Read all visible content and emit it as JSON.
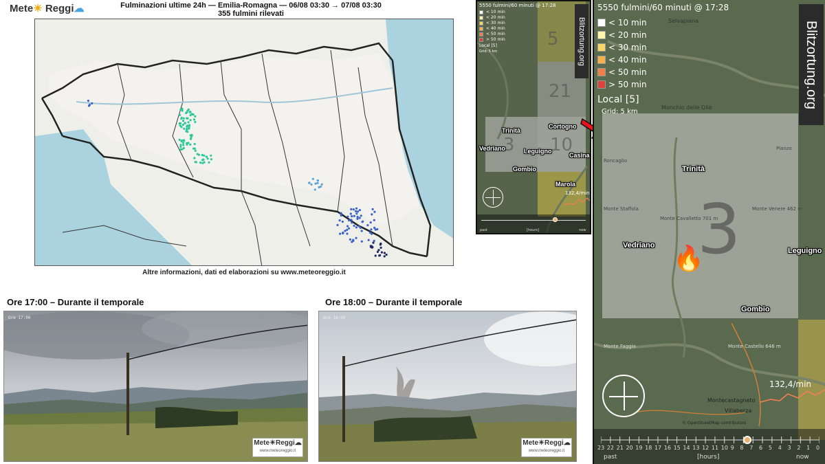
{
  "brand": {
    "name_a": "Mete",
    "name_b": "Reggi",
    "sun": "☀",
    "cloud": "☁"
  },
  "map": {
    "title_line1": "Fulminazioni ultime 24h — Emilia-Romagna — 06/08 03:30 → 07/08 03:30",
    "title_line2": "355 fulmini rilevati",
    "footer": "Altre informazioni, dati ed elaborazioni su www.meteoreggio.it"
  },
  "webcams": [
    {
      "caption": "Ore 17:00 – Durante il temporale",
      "logo": "Mete☀Reggi☁",
      "url": "www.meteoreggio.it"
    },
    {
      "caption": "Ore 18:00 – Durante il temporale",
      "logo": "Mete☀Reggi☁",
      "url": "www.meteoreggio.it"
    }
  ],
  "blitz_small": {
    "header": "5550 fulmini/60 minuti @ 17:28",
    "brand": "Blitzortung.org",
    "legend": [
      {
        "label": "< 10 min",
        "color": "#ffffff"
      },
      {
        "label": "< 20 min",
        "color": "#fff3b0"
      },
      {
        "label": "< 30 min",
        "color": "#f6d56b"
      },
      {
        "label": "< 40 min",
        "color": "#f3b04c"
      },
      {
        "label": "< 50 min",
        "color": "#ef7f49"
      },
      {
        "label": "> 50 min",
        "color": "#d9443c"
      }
    ],
    "local": "Local [5]",
    "grid": "Grid: 5 km",
    "cells": [
      "5",
      "21",
      "3",
      "10"
    ],
    "places": [
      "Trinità",
      "Cortogno",
      "Vedriano",
      "Leguigno",
      "Casina",
      "Gombio",
      "Marola"
    ],
    "rate": "132,4/min",
    "timeline_left": "past",
    "timeline_mid": "[hours]",
    "timeline_right": "now"
  },
  "blitz_large": {
    "header": "5550 fulmini/60 minuti @ 17:28",
    "brand": "Blitzortung.org",
    "legend": [
      {
        "label": "< 10 min",
        "color": "#ffffff"
      },
      {
        "label": "< 20 min",
        "color": "#fff3b0"
      },
      {
        "label": "< 30 min",
        "color": "#f6d56b"
      },
      {
        "label": "< 40 min",
        "color": "#f3b04c"
      },
      {
        "label": "< 50 min",
        "color": "#ef7f49"
      },
      {
        "label": "> 50 min",
        "color": "#d9443c"
      }
    ],
    "local": "Local [5]",
    "grid": "Grid: 5 km",
    "cell": "3",
    "places": [
      "Trinità",
      "Vedriano",
      "Leguigno",
      "Gombio"
    ],
    "map_labels": [
      "Selvapiana",
      "Monchio delle Olle",
      "Roncaglio",
      "Monte Staffola",
      "Monte Cavalletto 701 m",
      "Monte Venere 462 m",
      "Pianzo",
      "Monte Castello 646 m",
      "Montecastagneto",
      "Villaberza",
      "Monte Faggio",
      "© OpenStreetMap contributors"
    ],
    "rate": "132,4/min",
    "hours": [
      "23",
      "22",
      "21",
      "20",
      "19",
      "18",
      "17",
      "16",
      "15",
      "14",
      "13",
      "12",
      "11",
      "10",
      "9",
      "8",
      "7",
      "6",
      "5",
      "4",
      "3",
      "2",
      "1",
      "0"
    ],
    "timeline_left": "past",
    "timeline_mid": "[hours]",
    "timeline_right": "now"
  },
  "colors": {
    "accent_arrow": "#e8141b",
    "strike_teal": "#2ec79a",
    "strike_blue": "#3d63c9",
    "strike_navy": "#1f2a66"
  }
}
